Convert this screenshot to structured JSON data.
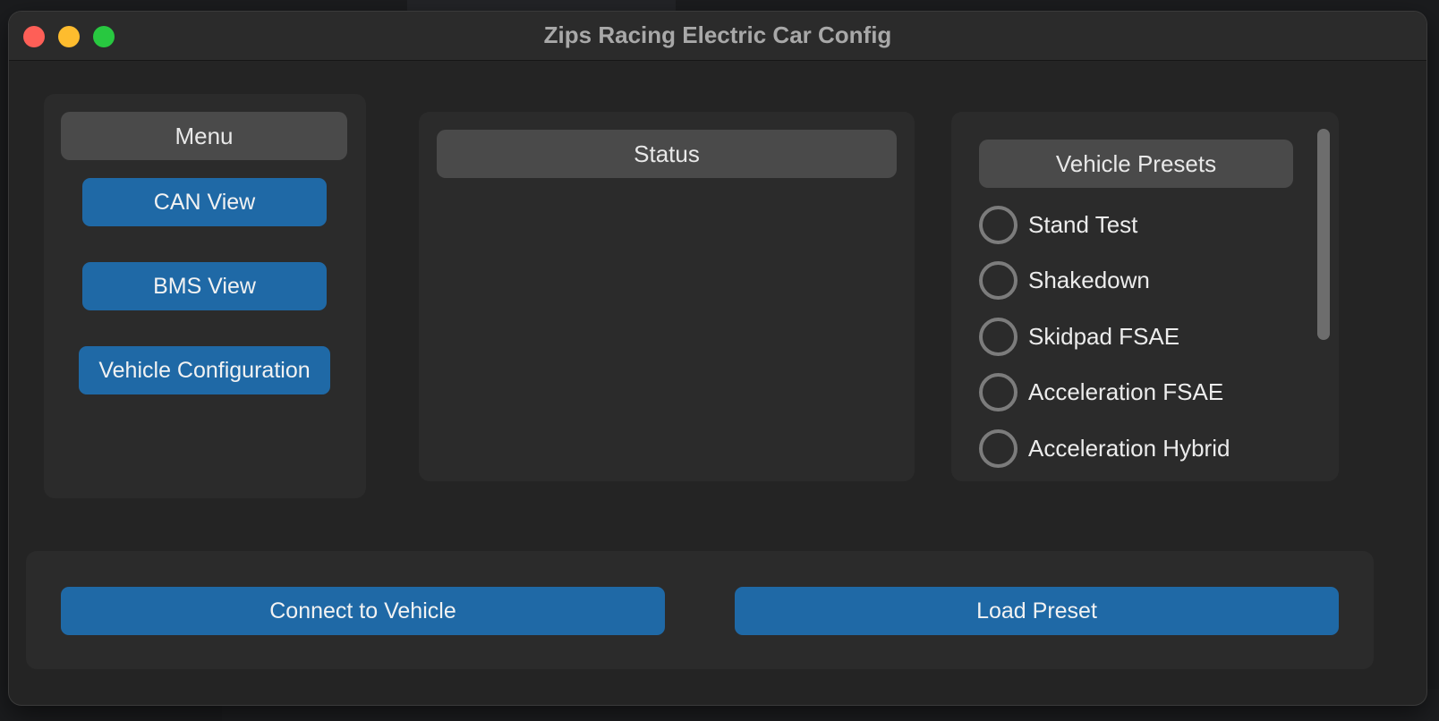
{
  "window": {
    "title": "Zips Racing Electric Car Config"
  },
  "menu": {
    "header": "Menu",
    "buttons": [
      "CAN View",
      "BMS View",
      "Vehicle Configuration"
    ]
  },
  "status": {
    "header": "Status"
  },
  "presets": {
    "header": "Vehicle Presets",
    "items": [
      {
        "label": "Stand Test",
        "selected": false
      },
      {
        "label": "Shakedown",
        "selected": false
      },
      {
        "label": "Skidpad FSAE",
        "selected": false
      },
      {
        "label": "Acceleration FSAE",
        "selected": false
      },
      {
        "label": "Acceleration Hybrid",
        "selected": false
      }
    ]
  },
  "actions": {
    "connect_label": "Connect to Vehicle",
    "load_label": "Load Preset"
  },
  "colors": {
    "accent": "#1f69a6",
    "window_bg": "#242424",
    "panel_bg": "#2b2b2b",
    "header_bg": "#4a4a4a"
  }
}
